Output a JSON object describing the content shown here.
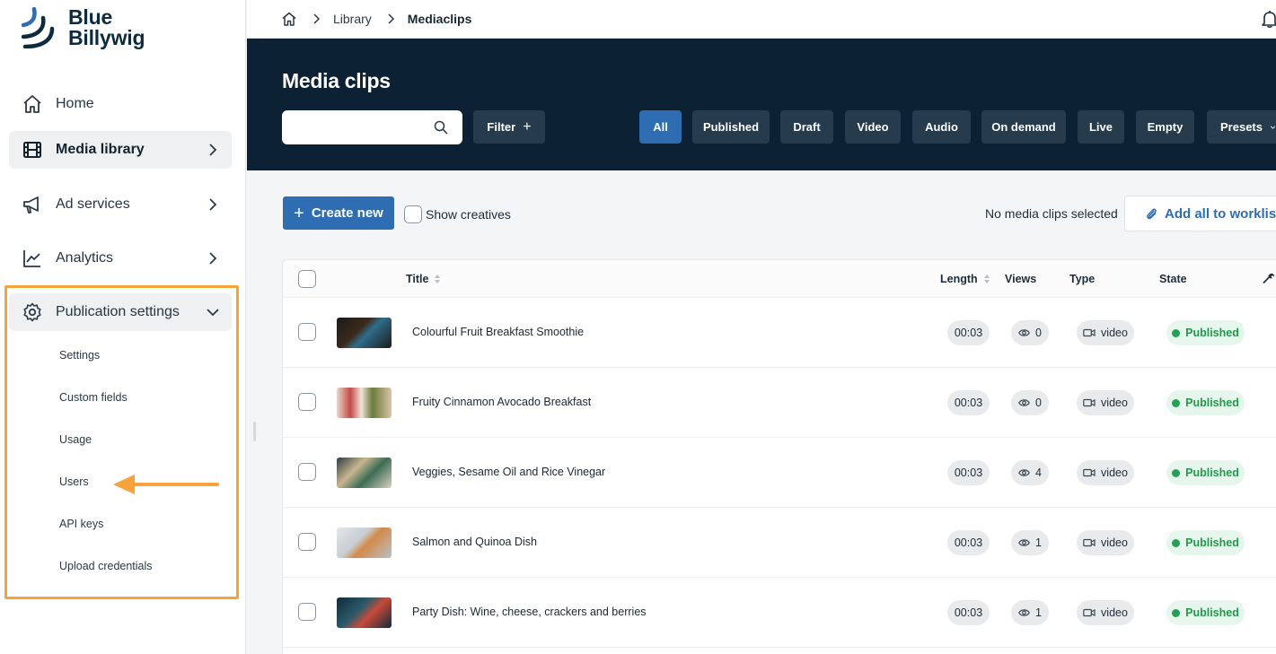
{
  "brand": {
    "line1": "Blue",
    "line2": "Billywig"
  },
  "sidebar": {
    "items": [
      {
        "label": "Home",
        "icon": "home-icon"
      },
      {
        "label": "Media library",
        "icon": "film-icon"
      },
      {
        "label": "Ad services",
        "icon": "megaphone-icon"
      },
      {
        "label": "Analytics",
        "icon": "chart-line-icon"
      },
      {
        "label": "Publication settings",
        "icon": "gear-icon"
      }
    ],
    "subitems": [
      "Settings",
      "Custom fields",
      "Usage",
      "Users",
      "API keys",
      "Upload credentials"
    ]
  },
  "breadcrumb": {
    "items": [
      "Library",
      "Mediaclips"
    ]
  },
  "header": {
    "title": "Media clips",
    "search_placeholder": "",
    "filter_label": "Filter",
    "chips": [
      "All",
      "Published",
      "Draft",
      "Video",
      "Audio",
      "On demand",
      "Live",
      "Empty",
      "Presets"
    ]
  },
  "toolbar": {
    "create_label": "Create new",
    "show_creatives_label": "Show creatives",
    "selection_status": "No media clips selected",
    "worklist_label": "Add all to worklist"
  },
  "table": {
    "columns": {
      "title": "Title",
      "length": "Length",
      "views": "Views",
      "type": "Type",
      "state": "State"
    },
    "rows": [
      {
        "title": "Colourful Fruit Breakfast Smoothie",
        "length": "00:03",
        "views": "0",
        "type": "video",
        "state": "Published"
      },
      {
        "title": "Fruity Cinnamon Avocado Breakfast",
        "length": "00:03",
        "views": "0",
        "type": "video",
        "state": "Published"
      },
      {
        "title": "Veggies, Sesame Oil and Rice Vinegar",
        "length": "00:03",
        "views": "4",
        "type": "video",
        "state": "Published"
      },
      {
        "title": "Salmon and Quinoa Dish",
        "length": "00:03",
        "views": "1",
        "type": "video",
        "state": "Published"
      },
      {
        "title": "Party Dish: Wine, cheese, crackers and berries",
        "length": "00:03",
        "views": "1",
        "type": "video",
        "state": "Published"
      }
    ]
  },
  "colors": {
    "accent": "#2f6db3",
    "header_bg": "#0c2234",
    "highlight": "#f6a33c",
    "published": "#1f9a4a"
  }
}
